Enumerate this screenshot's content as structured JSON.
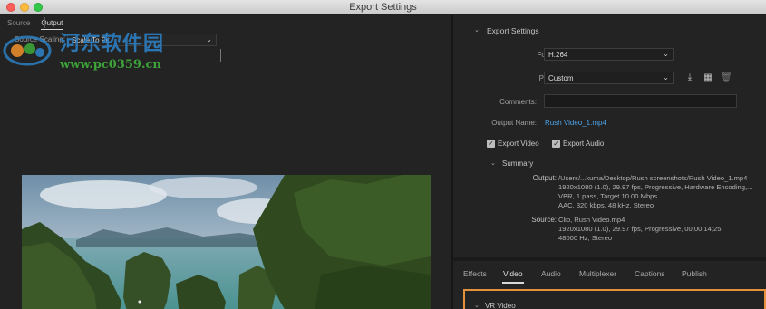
{
  "window": {
    "title": "Export Settings"
  },
  "left_panel": {
    "tabs": [
      {
        "label": "Source"
      },
      {
        "label": "Output"
      }
    ],
    "scaling": {
      "label": "Source Scaling:",
      "value": "Scale To Fit"
    }
  },
  "watermark": {
    "name": "河东软件园",
    "url": "www.pc0359.cn"
  },
  "export_settings": {
    "header": "Export Settings",
    "format": {
      "label": "Format:",
      "value": "H.264"
    },
    "preset": {
      "label": "Preset:",
      "value": "Custom"
    },
    "comments": {
      "label": "Comments:",
      "value": ""
    },
    "output_name": {
      "label": "Output Name:",
      "value": "Rush Video_1.mp4"
    },
    "export_video": {
      "label": "Export Video",
      "checked": true
    },
    "export_audio": {
      "label": "Export Audio",
      "checked": true
    },
    "summary": {
      "header": "Summary",
      "output_label": "Output:",
      "output_lines": [
        "/Users/...kuma/Desktop/Rush screenshots/Rush Video_1.mp4",
        "1920x1080 (1.0), 29.97 fps, Progressive, Hardware Encoding,...",
        "VBR, 1 pass, Target 10.00 Mbps",
        "AAC, 320 kbps, 48 kHz, Stereo"
      ],
      "source_label": "Source:",
      "source_lines": [
        "Clip, Rush Video.mp4",
        "1920x1080 (1.0), 29.97 fps, Progressive, 00;00;14;25",
        "48000 Hz, Stereo"
      ]
    }
  },
  "settings_tabs": [
    {
      "label": "Effects"
    },
    {
      "label": "Video"
    },
    {
      "label": "Audio"
    },
    {
      "label": "Multiplexer"
    },
    {
      "label": "Captions"
    },
    {
      "label": "Publish"
    }
  ],
  "active_tab": "Video",
  "video_section": {
    "header": "VR Video"
  },
  "colors": {
    "link": "#4da4ea",
    "highlight": "#e5903a",
    "background": "#232323"
  },
  "icons": {
    "save_preset": "download-icon",
    "import_preset": "import-icon",
    "delete_preset": "trash-icon"
  }
}
